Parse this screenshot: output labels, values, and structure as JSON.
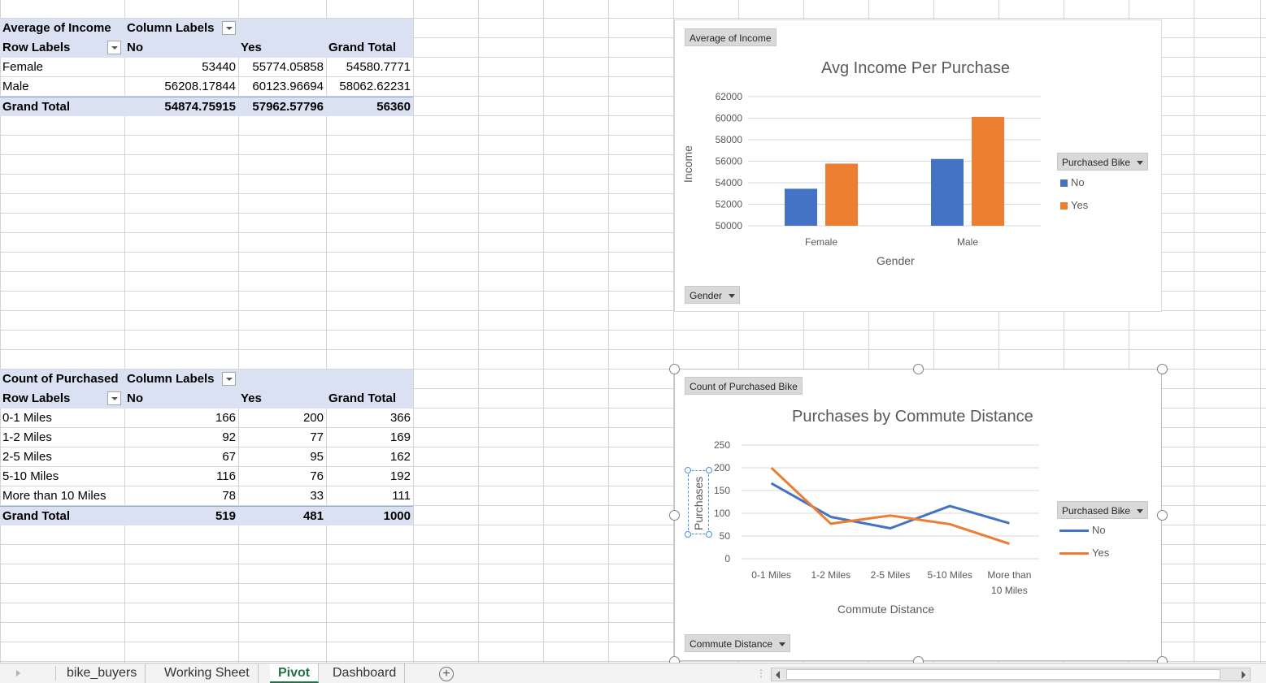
{
  "pivot_income": {
    "header1": "Average of Income",
    "header2": "Column Labels",
    "row_labels": "Row Labels",
    "columns": [
      "No",
      "Yes",
      "Grand Total"
    ],
    "rows": [
      {
        "label": "Female",
        "no": "53440",
        "yes": "55774.05858",
        "total": "54580.7771"
      },
      {
        "label": "Male",
        "no": "56208.17844",
        "yes": "60123.96694",
        "total": "58062.62231"
      }
    ],
    "grand_total": {
      "label": "Grand Total",
      "no": "54874.75915",
      "yes": "57962.57796",
      "total": "56360"
    }
  },
  "pivot_distance": {
    "header1": "Count of Purchased",
    "header2": "Column Labels",
    "row_labels": "Row Labels",
    "columns": [
      "No",
      "Yes",
      "Grand Total"
    ],
    "rows": [
      {
        "label": "0-1 Miles",
        "no": "166",
        "yes": "200",
        "total": "366"
      },
      {
        "label": "1-2 Miles",
        "no": "92",
        "yes": "77",
        "total": "169"
      },
      {
        "label": "2-5 Miles",
        "no": "67",
        "yes": "95",
        "total": "162"
      },
      {
        "label": "5-10 Miles",
        "no": "116",
        "yes": "76",
        "total": "192"
      },
      {
        "label": "More than 10 Miles",
        "no": "78",
        "yes": "33",
        "total": "111"
      }
    ],
    "grand_total": {
      "label": "Grand Total",
      "no": "519",
      "yes": "481",
      "total": "1000"
    }
  },
  "chart1": {
    "value_button": "Average of Income",
    "axis_button": "Gender",
    "legend_button": "Purchased Bike",
    "legend": [
      "No",
      "Yes"
    ]
  },
  "chart2": {
    "value_button": "Count of Purchased Bike",
    "axis_button": "Commute Distance",
    "legend_button": "Purchased Bike",
    "legend": [
      "No",
      "Yes"
    ]
  },
  "colors": {
    "no": "#4472c4",
    "yes": "#ed7d31"
  },
  "chart_data": [
    {
      "type": "bar",
      "title": "Avg Income Per Purchase",
      "xlabel": "Gender",
      "ylabel": "Income",
      "categories": [
        "Female",
        "Male"
      ],
      "series": [
        {
          "name": "No",
          "values": [
            53440,
            56208.17844
          ]
        },
        {
          "name": "Yes",
          "values": [
            55774.05858,
            60123.96694
          ]
        }
      ],
      "ylim": [
        50000,
        62000
      ],
      "yticks": [
        50000,
        52000,
        54000,
        56000,
        58000,
        60000,
        62000
      ],
      "grid": true,
      "legend": "right"
    },
    {
      "type": "line",
      "title": "Purchases by Commute Distance",
      "xlabel": "Commute Distance",
      "ylabel": "Purchases",
      "categories": [
        "0-1 Miles",
        "1-2 Miles",
        "2-5 Miles",
        "5-10 Miles",
        "More than 10 Miles"
      ],
      "series": [
        {
          "name": "No",
          "values": [
            166,
            92,
            67,
            116,
            78
          ]
        },
        {
          "name": "Yes",
          "values": [
            200,
            77,
            95,
            76,
            33
          ]
        }
      ],
      "ylim": [
        0,
        250
      ],
      "yticks": [
        0,
        50,
        100,
        150,
        200,
        250
      ],
      "grid": true,
      "legend": "right"
    }
  ],
  "tabs": [
    "bike_buyers",
    "Working Sheet",
    "Pivot",
    "Dashboard"
  ],
  "active_tab": "Pivot",
  "add_sheet_icon": "plus-circle-icon"
}
